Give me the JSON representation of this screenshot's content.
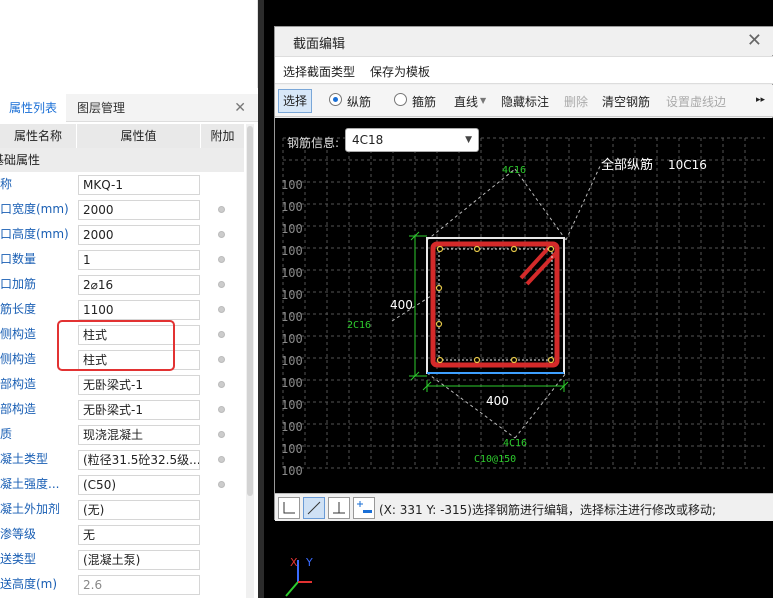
{
  "left_panel": {
    "tabs": [
      {
        "label": "属性列表"
      },
      {
        "label": "图层管理"
      }
    ],
    "close_glyph": "✕",
    "headers": {
      "name": "属性名称",
      "value": "属性值",
      "extra": "附加"
    },
    "section": "基础属性",
    "rows": [
      {
        "name": "名称",
        "value": "MKQ-1"
      },
      {
        "name": "洞口宽度(mm)",
        "value": "2000"
      },
      {
        "name": "洞口高度(mm)",
        "value": "2000"
      },
      {
        "name": "洞口数量",
        "value": "1"
      },
      {
        "name": "洞口加筋",
        "value": "2⌀16"
      },
      {
        "name": "加筋长度",
        "value": "1100"
      },
      {
        "name": "左侧构造",
        "value": "柱式"
      },
      {
        "name": "右侧构造",
        "value": "柱式"
      },
      {
        "name": "上部构造",
        "value": "无卧梁式-1"
      },
      {
        "name": "下部构造",
        "value": "无卧梁式-1"
      },
      {
        "name": "材质",
        "value": "现浇混凝土"
      },
      {
        "name": "混凝土类型",
        "value": "(粒径31.5砼32.5级..."
      },
      {
        "name": "混凝土强度...",
        "value": "(C50)"
      },
      {
        "name": "混凝土外加剂",
        "value": "(无)"
      },
      {
        "name": "抗渗等级",
        "value": "无"
      },
      {
        "name": "泵送类型",
        "value": "(混凝土泵)"
      },
      {
        "name": "泵送高度(m)",
        "value": "2.6"
      }
    ]
  },
  "dialog": {
    "title": "截面编辑",
    "close_glyph": "✕",
    "menu": [
      "选择截面类型",
      "保存为模板"
    ],
    "toolbar": {
      "select": "选择",
      "longitudinal": "纵筋",
      "stirrup": "箍筋",
      "line": "直线",
      "hide_annot": "隐藏标注",
      "delete": "删除",
      "clear": "清空钢筋",
      "set_dashed": "设置虚线边",
      "more": "▸▸"
    },
    "rebar_info_label": "钢筋信息:",
    "rebar_info_value": "4C18",
    "drawing": {
      "all_longitudinal_label": "全部纵筋",
      "all_longitudinal_value": "10C16",
      "top_bars": "4C16",
      "left_bars": "2C16",
      "bottom_bars": "4C16",
      "stirrup": "C10@150",
      "dim_width": "400",
      "dim_height": "400",
      "grid_labels": [
        "100",
        "100",
        "100",
        "100",
        "100",
        "100",
        "100",
        "100",
        "100",
        "100",
        "100",
        "100",
        "100",
        "100"
      ]
    },
    "status": "(X: 331 Y: -315)选择钢筋进行编辑，选择标注进行修改或移动;"
  },
  "axis": {
    "x": "X",
    "y": "Y"
  },
  "colors": {
    "accent": "#1a6fd6",
    "highlight": "#e23232",
    "rebar": "#d42a2a",
    "dim": "#2ecc2e"
  }
}
